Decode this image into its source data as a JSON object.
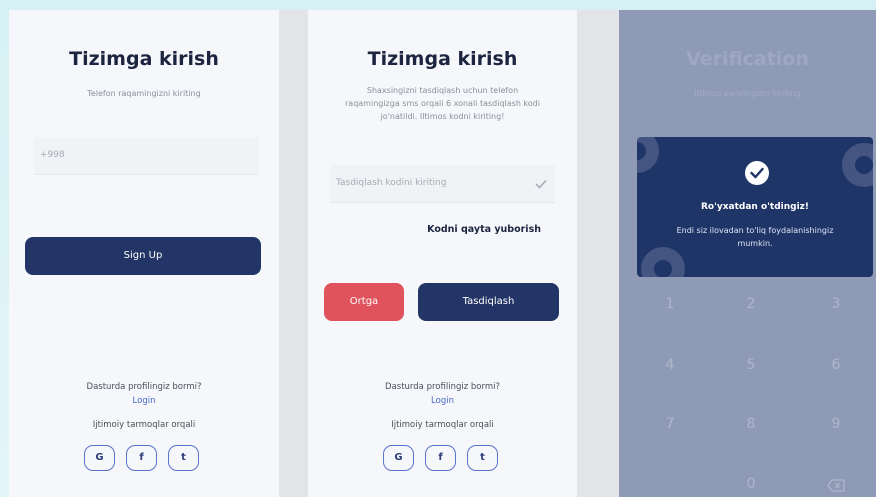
{
  "screen1": {
    "title": "Tizimga kirish",
    "subtitle": "Telefon raqamingizni kiriting",
    "phone_prefix": "+998",
    "signup_label": "Sign Up",
    "question": "Dasturda profilingiz bormi?",
    "login_link": "Login",
    "social_label": "Ijtimoiy tarmoqlar orqali",
    "social": [
      "G",
      "f",
      "t"
    ]
  },
  "screen2": {
    "title": "Tizimga kirish",
    "subtitle_lines": [
      "Shaxsingizni tasdiqlash uchun telefon",
      "raqamingizga sms orqali 6 xonali tasdiqlash kodi",
      "jo'natildi. Iltimos kodni kiriting!"
    ],
    "code_placeholder": "Tasdiqlash kodini kiriting",
    "resend_label": "Kodni qayta yuborish",
    "back_label": "Ortga",
    "confirm_label": "Tasdiqlash",
    "question": "Dasturda profilingiz bormi?",
    "login_link": "Login",
    "social_label": "Ijtimoiy tarmoqlar orqali",
    "social": [
      "G",
      "f",
      "t"
    ]
  },
  "screen3": {
    "title": "Verification",
    "subtitle": "Iltimos parolingizni kiriting",
    "modal": {
      "title": "Ro'yxatdan o'tdingiz!",
      "text_lines": [
        "Endi siz ilovadan to'liq foydalanishingiz",
        "mumkin."
      ]
    },
    "keys": [
      "1",
      "2",
      "3",
      "4",
      "5",
      "6",
      "7",
      "8",
      "9",
      "0"
    ]
  },
  "colors": {
    "navy": "#233467",
    "red": "#e0525c",
    "link": "#4867c9",
    "overlay": "#8f9bb6"
  }
}
